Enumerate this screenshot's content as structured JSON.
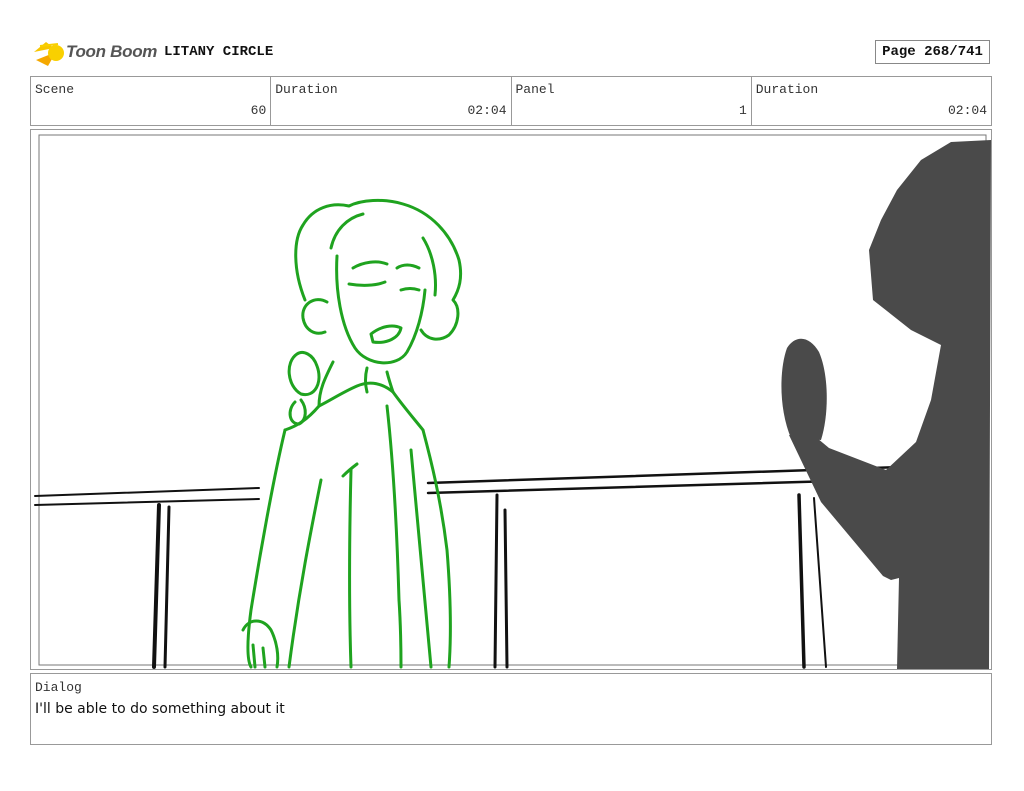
{
  "header": {
    "logo_text": "Toon Boom",
    "project_title": "LITANY CIRCLE",
    "page_label": "Page 268/741"
  },
  "info": {
    "scene_label": "Scene",
    "scene_value": "60",
    "scene_duration_label": "Duration",
    "scene_duration_value": "02:04",
    "panel_label": "Panel",
    "panel_value": "1",
    "panel_duration_label": "Duration",
    "panel_duration_value": "02:04"
  },
  "dialog": {
    "label": "Dialog",
    "text": "I'll be able to do something about it"
  },
  "colors": {
    "sketch_green": "#1fa31f",
    "silhouette": "#4a4a4a",
    "logo_yellow": "#f5b800"
  }
}
